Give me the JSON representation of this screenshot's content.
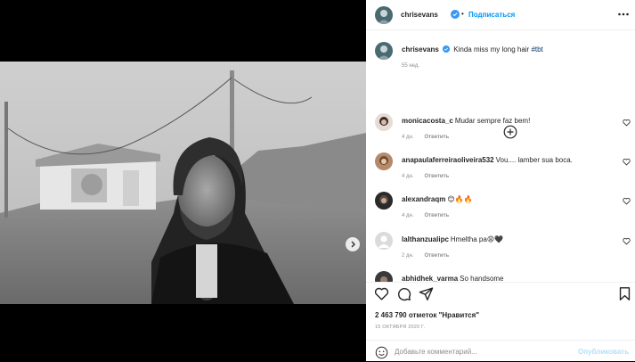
{
  "post": {
    "author": "chrisevans",
    "follow_label": "Подписаться",
    "caption_text": "Kinda miss my long hair",
    "caption_hashtag": "#tbt",
    "caption_time": "55 нед."
  },
  "comments": [
    {
      "user": "monicacosta_c",
      "text": "Mudar sempre faz bem!",
      "time": "4 дн.",
      "reply": "Ответить"
    },
    {
      "user": "anapaulaferreiraoliveira532",
      "text": "Vou.... lamber sua boca.",
      "time": "4 дн.",
      "reply": "Ответить"
    },
    {
      "user": "alexandraqm",
      "text": "😊🔥🔥",
      "time": "4 дн.",
      "reply": "Ответить"
    },
    {
      "user": "lalthanzualipc",
      "text": "Hmeltha pa😩🖤",
      "time": "2 дн.",
      "reply": "Ответить"
    },
    {
      "user": "abhidhek_varma",
      "text": "So handsome",
      "time": "",
      "reply": ""
    }
  ],
  "likes_text": "2 463 790 отметок \"Нравится\"",
  "date_text": "15 ОКТЯБРЯ 2020 Г.",
  "comment_input": {
    "placeholder": "Добавьте комментарий...",
    "value": ""
  },
  "publish_label": "Опубликовать",
  "carousel": {
    "slide_count": 2,
    "current_slide": 1
  },
  "colors": {
    "accent": "#0095f6",
    "verified": "#3897f0",
    "text": "#262626",
    "muted": "#8e8e8e"
  },
  "icons": {
    "more": "more-horizontal-icon",
    "add": "plus-circle-icon",
    "like": "heart-icon",
    "comment": "comment-bubble-icon",
    "share": "paper-plane-icon",
    "save": "bookmark-icon",
    "emoji": "smiley-icon",
    "next": "chevron-right-icon"
  }
}
